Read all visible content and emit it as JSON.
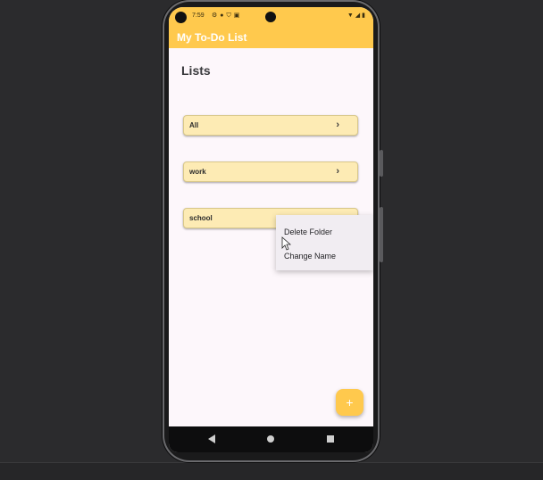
{
  "status_bar": {
    "time": "7:59",
    "left_icons": [
      "settings-icon",
      "notification-icon",
      "shield-icon",
      "clipboard-icon"
    ],
    "right_icons": [
      "wifi-icon",
      "signal-icon",
      "battery-icon"
    ]
  },
  "app_bar": {
    "title": "My To-Do List"
  },
  "main": {
    "heading": "Lists",
    "lists": [
      {
        "label": "All"
      },
      {
        "label": "work"
      },
      {
        "label": "school"
      }
    ]
  },
  "context_menu": {
    "items": [
      {
        "label": "Delete Folder"
      },
      {
        "label": "Change Name"
      }
    ]
  },
  "fab": {
    "label": "+"
  },
  "colors": {
    "accent": "#ffc94d",
    "card_bg": "#fdebb4",
    "screen_bg": "#fdf7fb",
    "menu_bg": "#f1edf2"
  }
}
